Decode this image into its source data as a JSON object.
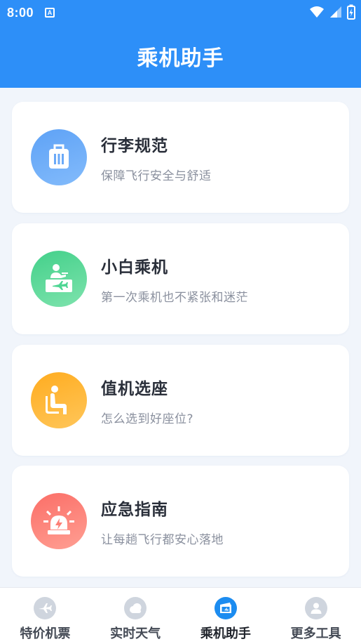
{
  "status_bar": {
    "time": "8:00",
    "notification_badge": "A"
  },
  "header": {
    "title": "乘机助手",
    "background_color": "#2d8ff8"
  },
  "cards": [
    {
      "title": "行李规范",
      "subtitle": "保障飞行安全与舒适",
      "icon": "luggage-icon",
      "color": "#6aa9f8"
    },
    {
      "title": "小白乘机",
      "subtitle": "第一次乘机也不紧张和迷茫",
      "icon": "check-in-counter-icon",
      "color": "#4fd694"
    },
    {
      "title": "值机选座",
      "subtitle": "怎么选到好座位?",
      "icon": "seat-icon",
      "color": "#ffb535"
    },
    {
      "title": "应急指南",
      "subtitle": "让每趟飞行都安心落地",
      "icon": "emergency-light-icon",
      "color": "#fd8077"
    }
  ],
  "tabbar": {
    "active_color": "#1c8cf0",
    "tabs": [
      {
        "label": "特价机票",
        "icon": "airplane-icon",
        "active": false
      },
      {
        "label": "实时天气",
        "icon": "cloud-icon",
        "active": false
      },
      {
        "label": "乘机助手",
        "icon": "ticket-icon",
        "active": true
      },
      {
        "label": "更多工具",
        "icon": "user-icon",
        "active": false
      }
    ]
  }
}
